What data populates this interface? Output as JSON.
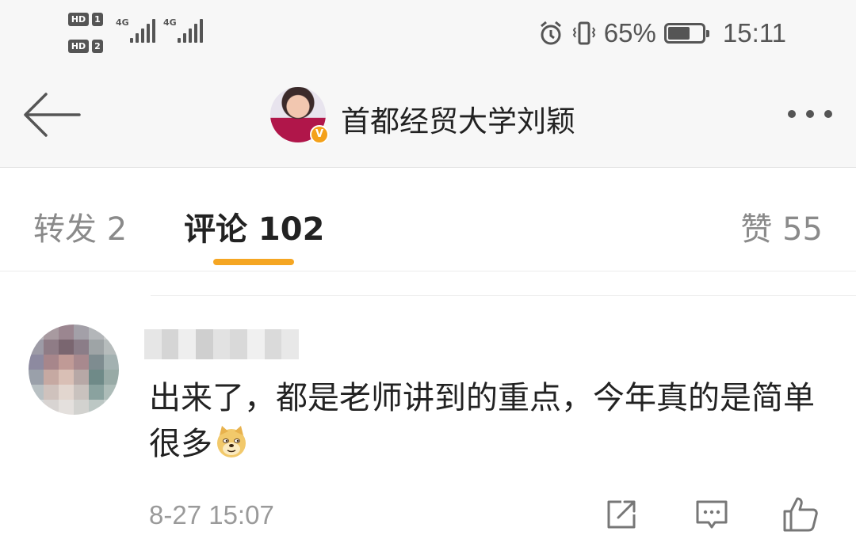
{
  "status_bar": {
    "sim1_label": "HD",
    "sim1_num": "1",
    "sim2_label": "HD",
    "sim2_num": "2",
    "net1": "4G",
    "net2": "4G",
    "battery_percent_text": "65%",
    "battery_level": 0.65,
    "time": "15:11"
  },
  "nav": {
    "title": "首都经贸大学刘颖",
    "verified_badge": "V",
    "back_icon": "arrow-left-icon",
    "more_icon": "more-dots-icon"
  },
  "tabs": [
    {
      "label": "转发 2"
    },
    {
      "label": "评论 102",
      "active": true
    },
    {
      "label": "赞 55"
    }
  ],
  "comment": {
    "text": "出来了，都是老师讲到的重点，今年真的是简单很多",
    "emoji": "doge-emoji",
    "time": "8-27 15:07",
    "actions": [
      "share-icon",
      "reply-icon",
      "like-icon"
    ]
  },
  "colors": {
    "accent": "#f5a623",
    "header_bg": "#f7f7f7",
    "verified": "#f4a11a"
  }
}
